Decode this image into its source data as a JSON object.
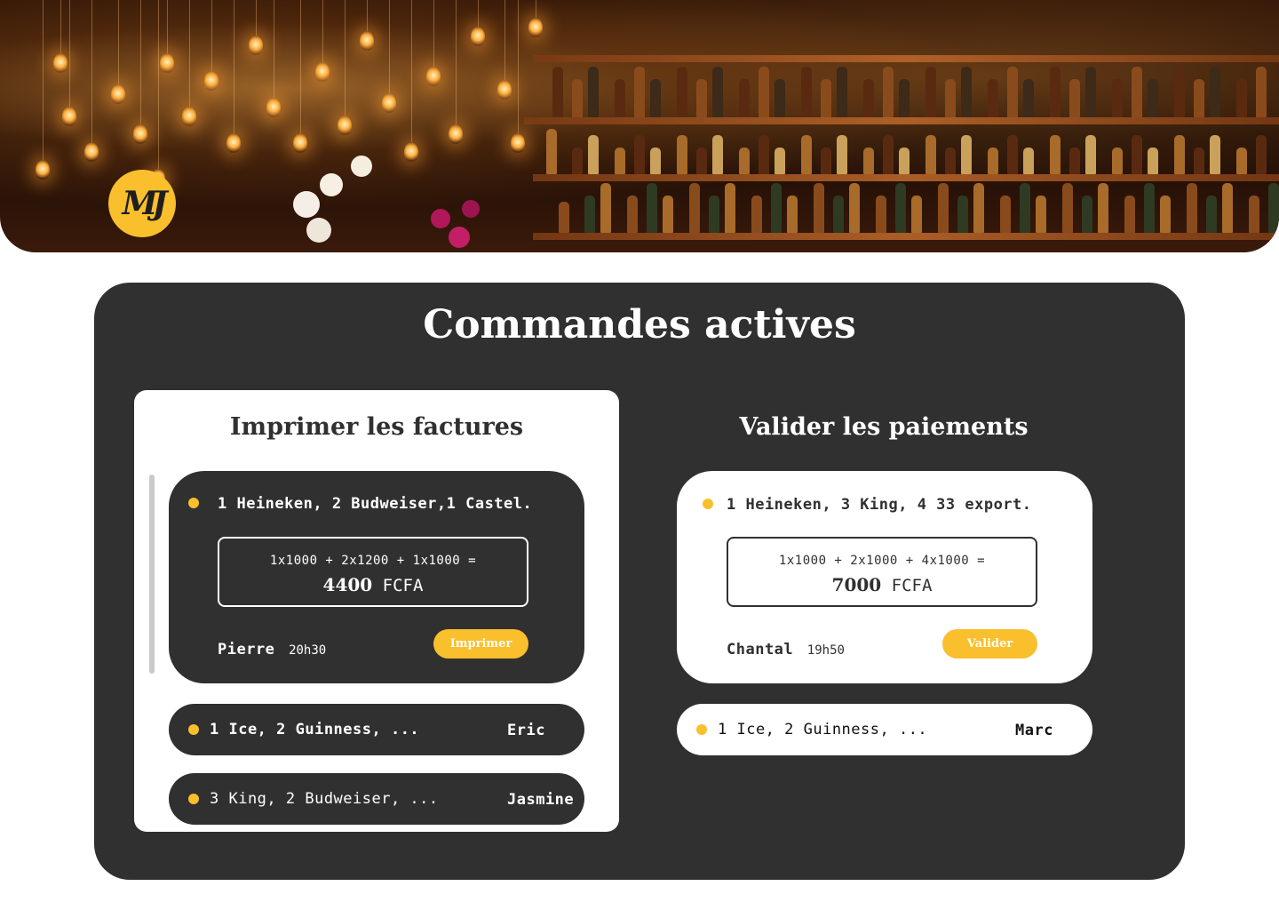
{
  "brand": {
    "logo_text": "MJ"
  },
  "page_title": "Commandes actives",
  "print_section": {
    "title": "Imprimer les factures",
    "active_order": {
      "items": "1 Heineken, 2 Budweiser,1 Castel.",
      "formula": "1x1000 + 2x1200 + 1x1000 =",
      "total": "4400",
      "currency": "FCFA",
      "customer": "Pierre",
      "time": "20h30",
      "button_label": "Imprimer"
    },
    "orders": [
      {
        "items": "1 Ice, 2 Guinness, ...",
        "customer": "Eric"
      },
      {
        "items": "3 King, 2 Budweiser, ...",
        "customer": "Jasmine"
      }
    ]
  },
  "validate_section": {
    "title": "Valider les paiements",
    "active_order": {
      "items": "1 Heineken, 3 King, 4 33 export.",
      "formula": "1x1000 + 2x1000 + 4x1000 =",
      "total": "7000",
      "currency": "FCFA",
      "customer": "Chantal",
      "time": "19h50",
      "button_label": "Valider"
    },
    "orders": [
      {
        "items": "1 Ice, 2 Guinness, ...",
        "customer": "Marc"
      }
    ]
  },
  "colors": {
    "accent": "#f9bf2c",
    "panel": "#303030",
    "white": "#ffffff"
  }
}
